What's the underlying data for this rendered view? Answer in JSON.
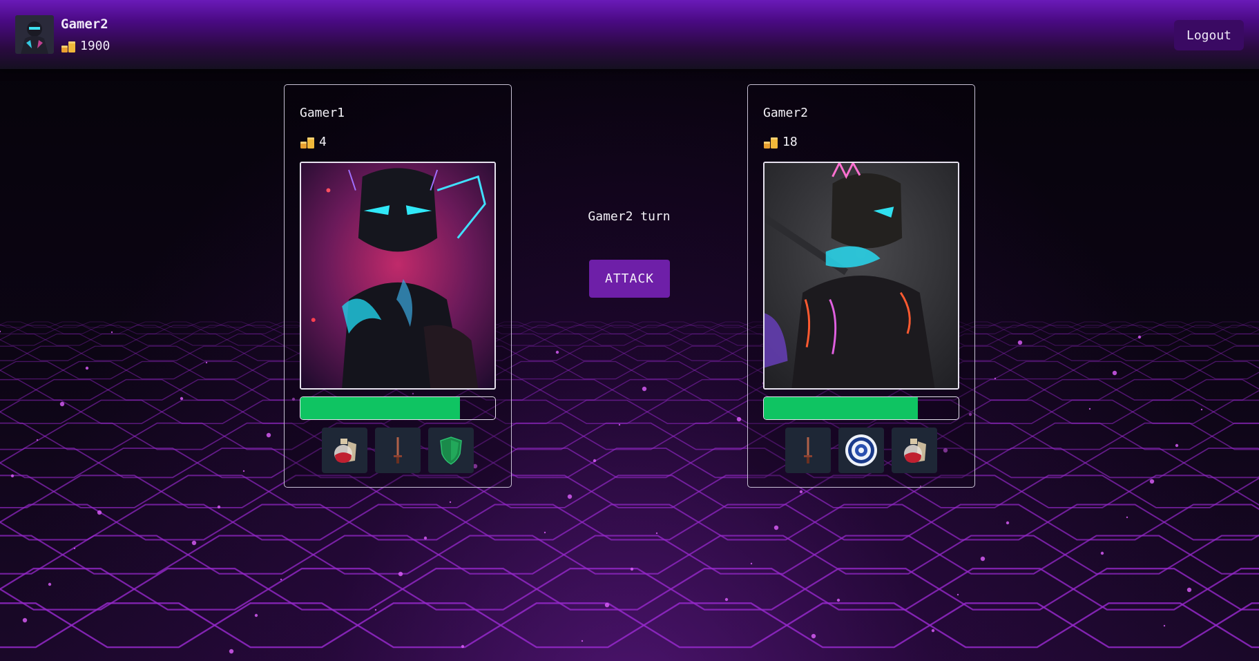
{
  "header": {
    "username": "Gamer2",
    "coins": "1900",
    "logout_label": "Logout",
    "avatar_icon": "warrior-avatar-icon",
    "coin_icon": "coin-stack-icon"
  },
  "battle": {
    "turn_text": "Gamer2 turn",
    "attack_label": "ATTACK"
  },
  "players": [
    {
      "name": "Gamer1",
      "coins": "4",
      "health_fraction": 0.82,
      "portrait_icon": "cyber-knight-portrait",
      "items": [
        {
          "name": "potion",
          "icon": "potion-icon"
        },
        {
          "name": "dagger",
          "icon": "dagger-icon"
        },
        {
          "name": "shield",
          "icon": "shield-icon"
        }
      ]
    },
    {
      "name": "Gamer2",
      "coins": "18",
      "health_fraction": 0.79,
      "portrait_icon": "cyber-warrior-portrait",
      "items": [
        {
          "name": "dagger",
          "icon": "dagger-icon"
        },
        {
          "name": "emblem",
          "icon": "emblem-icon"
        },
        {
          "name": "potion",
          "icon": "potion-icon"
        }
      ]
    }
  ],
  "colors": {
    "accent": "#6e1fa8",
    "health": "#0fc462",
    "header_top": "#6a1ab8"
  }
}
